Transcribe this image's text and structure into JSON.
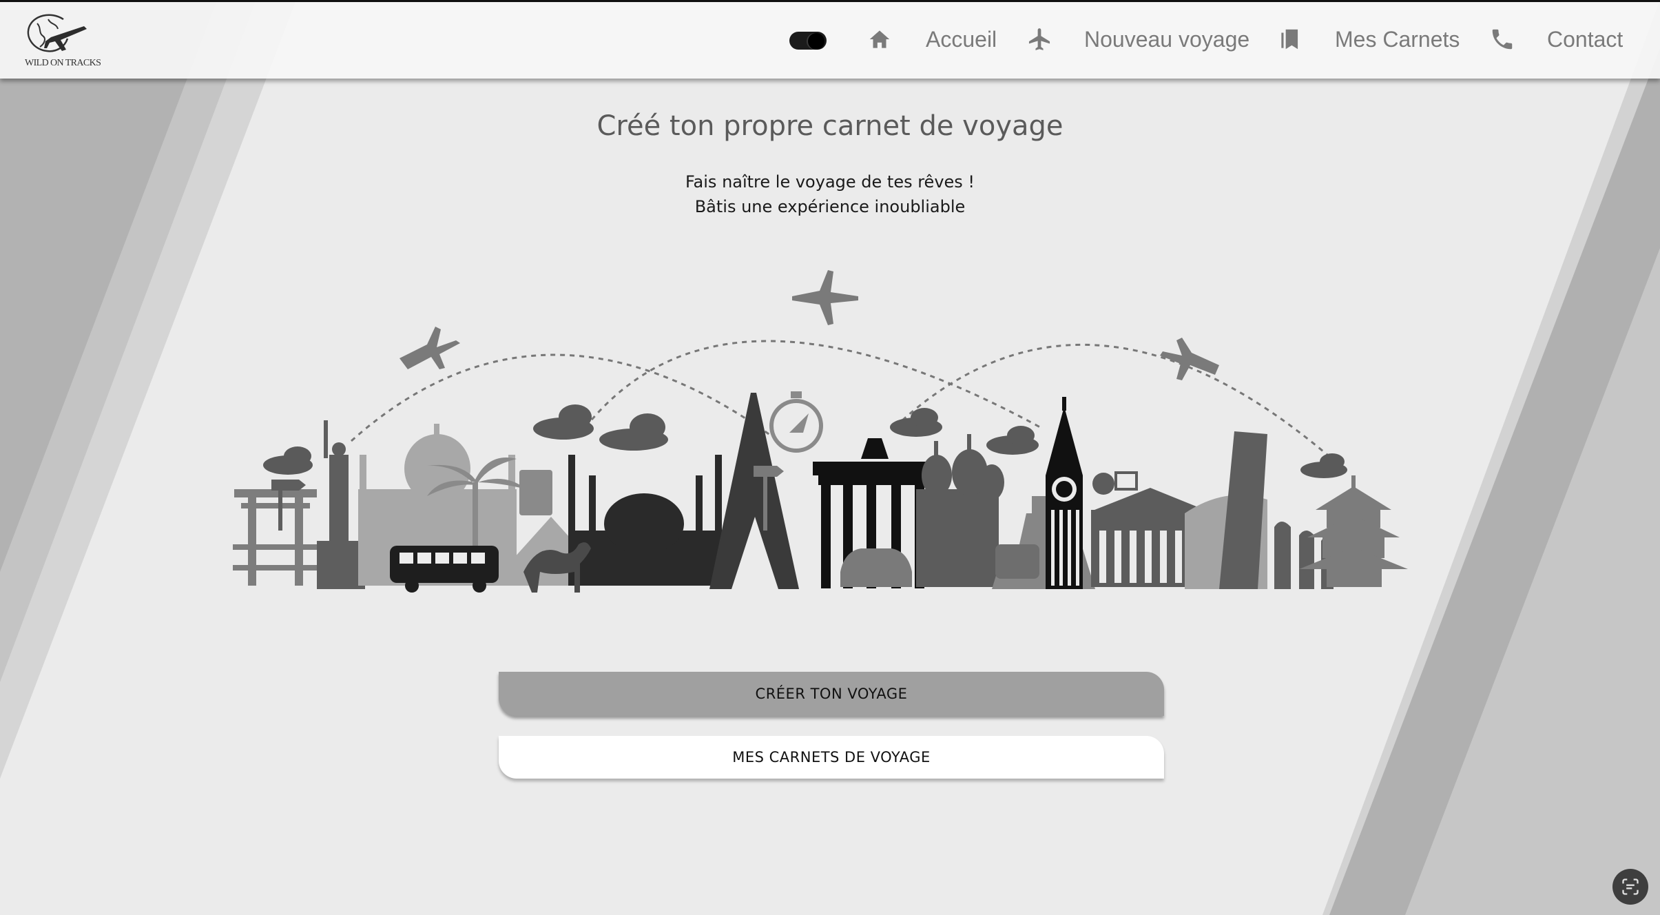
{
  "header": {
    "logo_text": "WILD ON TRACKS",
    "theme_toggle": {
      "on": true
    },
    "nav": [
      {
        "icon": "home-icon",
        "label": "Accueil"
      },
      {
        "icon": "airplane-icon",
        "label": "Nouveau voyage"
      },
      {
        "icon": "bookmark-icon",
        "label": "Mes Carnets"
      },
      {
        "icon": "phone-icon",
        "label": "Contact"
      }
    ]
  },
  "hero": {
    "title": "Créé ton propre carnet de voyage",
    "subtitle_line1": "Fais naître le voyage de tes rêves !",
    "subtitle_line2": "Bâtis une expérience inoubliable"
  },
  "illustration": {
    "name": "world-landmarks-skyline"
  },
  "actions": {
    "primary_label": "CRÉER TON VOYAGE",
    "secondary_label": "MES CARNETS DE VOYAGE"
  },
  "floating": {
    "icon": "scan-text-icon"
  },
  "colors": {
    "page_background": "#ebebeb",
    "nav_text": "#7a7a7a",
    "title_text": "#5a5a5a",
    "primary_button": "#a0a0a0",
    "secondary_button": "#ffffff"
  }
}
